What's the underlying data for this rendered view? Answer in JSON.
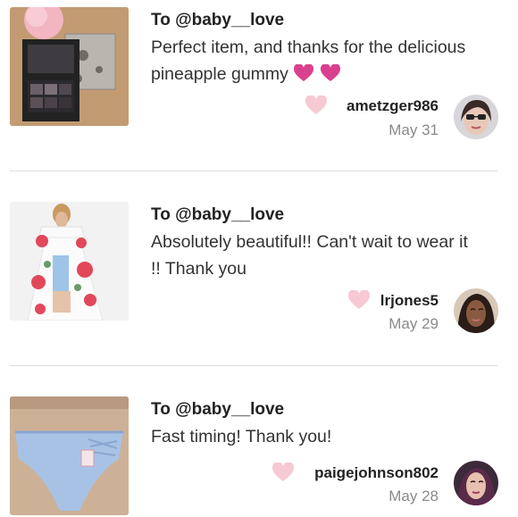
{
  "reviews": [
    {
      "to": "To @baby__love",
      "message": "Perfect item, and thanks for the delicious pineapple gummy",
      "username": "ametzger986",
      "date": "May 31",
      "thumb_icon": "eyeshadow-palette-photo",
      "colors": {
        "heart": "#f7c9d2",
        "inline_heart": "#d9418e"
      }
    },
    {
      "to": "To @baby__love",
      "message": "Absolutely beautiful!! Can't wait to wear it !! Thank you",
      "username": "lrjones5",
      "date": "May 29",
      "thumb_icon": "floral-dress-photo"
    },
    {
      "to": "To @baby__love",
      "message": "Fast timing! Thank you!",
      "username": "paigejohnson802",
      "date": "May 28",
      "thumb_icon": "blue-underwear-photo"
    }
  ]
}
